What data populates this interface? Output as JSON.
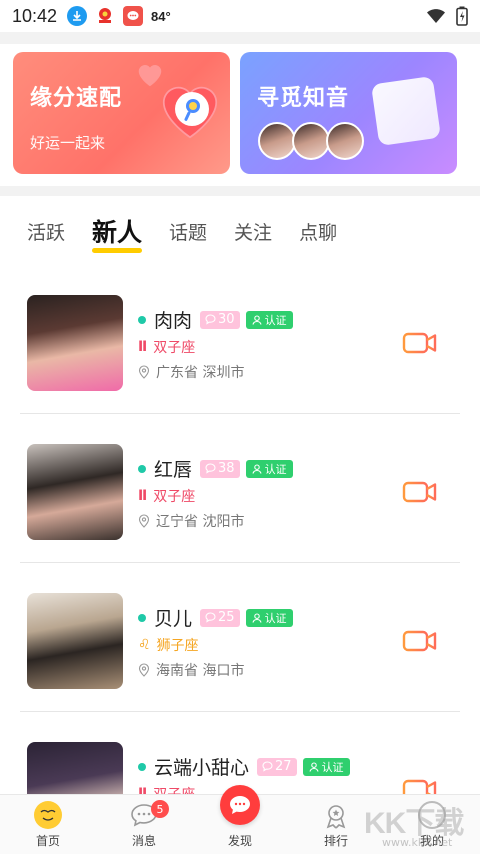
{
  "status_bar": {
    "time": "10:42",
    "temperature": "84°",
    "icons": [
      "download-icon",
      "party-icon",
      "message-app-icon",
      "wifi-icon",
      "battery-icon"
    ]
  },
  "banners": [
    {
      "title": "缘分速配",
      "subtitle": "好运一起来",
      "color": "#ff7d72"
    },
    {
      "title": "寻觅知音",
      "color": "#8f8dff"
    }
  ],
  "tabs": [
    {
      "label": "活跃",
      "active": false
    },
    {
      "label": "新人",
      "active": true
    },
    {
      "label": "话题",
      "active": false
    },
    {
      "label": "关注",
      "active": false
    },
    {
      "label": "点聊",
      "active": false
    }
  ],
  "users": [
    {
      "name": "肉肉",
      "age": "30",
      "verify": "认证",
      "zodiac_symbol": "Ⅱ",
      "zodiac": "双子座",
      "zodiac_color": "#ef4a67",
      "location": "广东省 深圳市"
    },
    {
      "name": "红唇",
      "age": "38",
      "verify": "认证",
      "zodiac_symbol": "Ⅱ",
      "zodiac": "双子座",
      "zodiac_color": "#ef4a67",
      "location": "辽宁省 沈阳市"
    },
    {
      "name": "贝儿",
      "age": "25",
      "verify": "认证",
      "zodiac_symbol": "♌",
      "zodiac": "狮子座",
      "zodiac_color": "#f5a623",
      "location": "海南省 海口市"
    },
    {
      "name": "云端小甜心",
      "age": "27",
      "verify": "认证",
      "zodiac_symbol": "Ⅱ",
      "zodiac": "双子座",
      "zodiac_color": "#ef4a67",
      "location": ""
    }
  ],
  "bottom_nav": [
    {
      "label": "首页",
      "icon": "home-icon",
      "active": true
    },
    {
      "label": "消息",
      "icon": "message-icon",
      "badge": "5"
    },
    {
      "label": "发现",
      "icon": "discover-icon"
    },
    {
      "label": "排行",
      "icon": "rank-icon"
    },
    {
      "label": "我的",
      "icon": "profile-icon"
    }
  ],
  "watermark": {
    "text": "KK下载",
    "url": "www.kkx.net"
  }
}
